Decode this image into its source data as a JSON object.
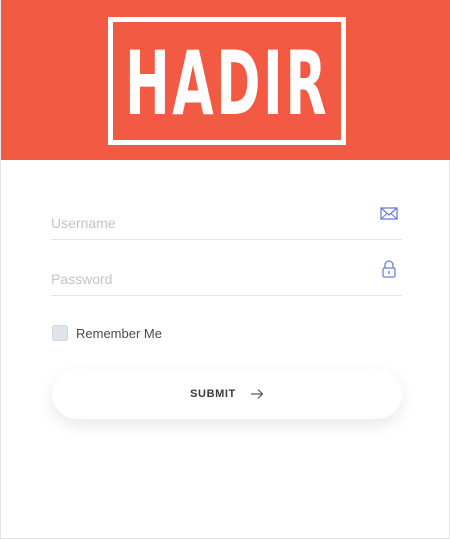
{
  "brand": {
    "logo_text": "HADIR",
    "header_color": "#f25a43",
    "icon_color": "#6b7fd7"
  },
  "form": {
    "username": {
      "placeholder": "Username",
      "value": "",
      "icon": "mail-icon"
    },
    "password": {
      "placeholder": "Password",
      "value": "",
      "icon": "lock-icon"
    },
    "remember": {
      "label": "Remember Me",
      "checked": false
    },
    "submit": {
      "label": "SUBMIT",
      "icon": "arrow-right-icon"
    }
  }
}
